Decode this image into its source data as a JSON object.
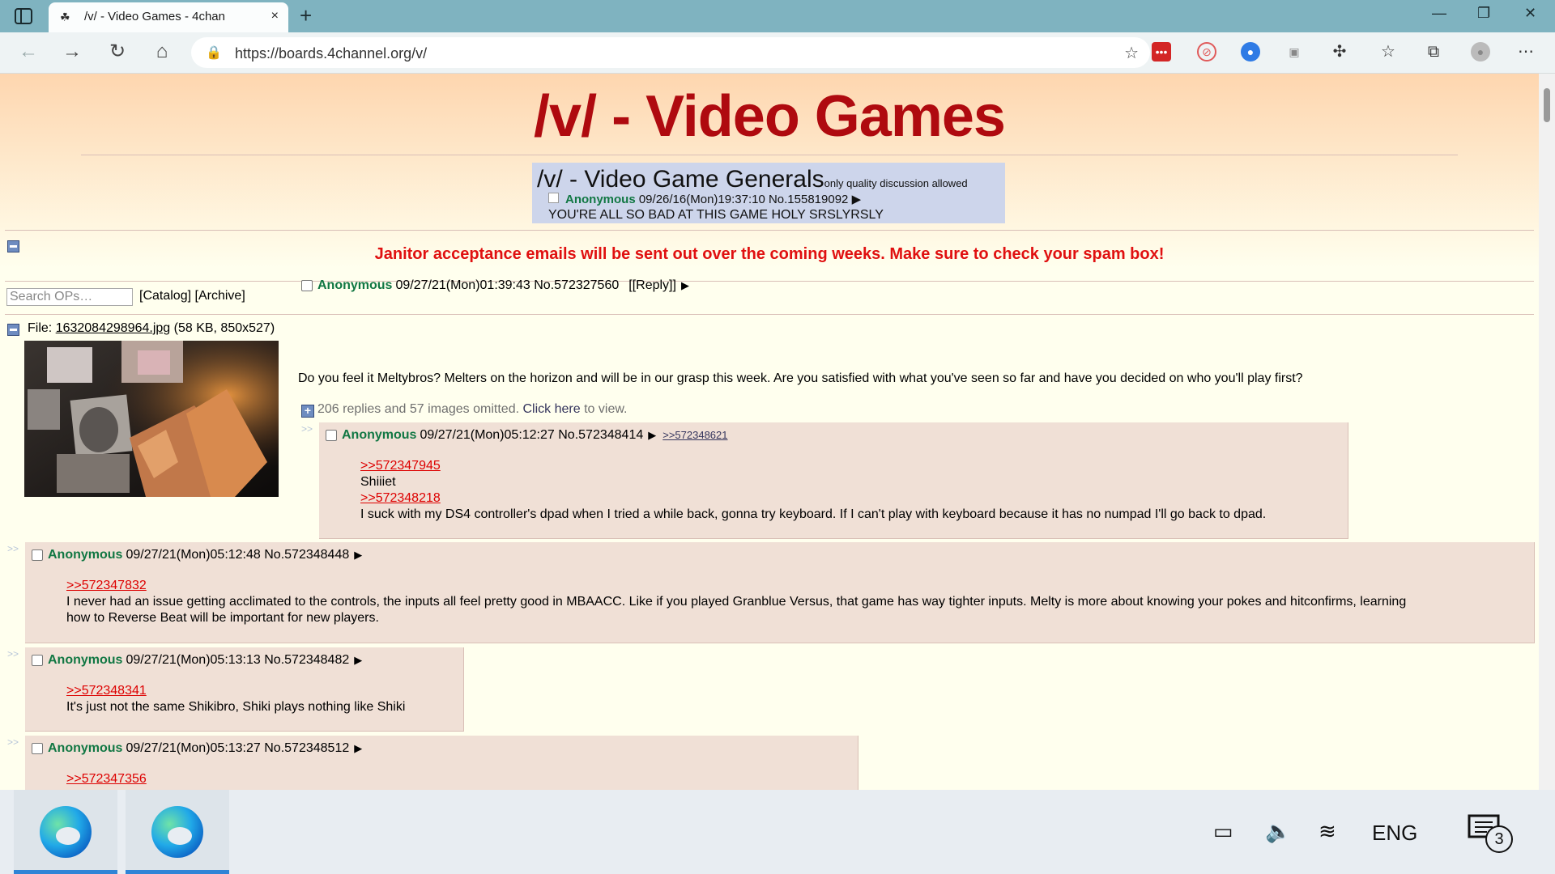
{
  "browser": {
    "tab_title": "/v/ - Video Games - 4chan",
    "url": "https://boards.4channel.org/v/",
    "new_tab": "+",
    "close_tab": "×"
  },
  "board": {
    "title": "/v/ - Video Games",
    "banner": {
      "title_main": "/v/  - Video Game Generals",
      "title_small": "only quality discussion allowed",
      "poster": "Anonymous",
      "meta": "09/26/16(Mon)19:37:10 No.155819092",
      "body": "YOU'RE ALL SO BAD AT THIS GAME HOLY SRSLYRSLY"
    },
    "announcement": "Janitor acceptance emails will be sent out over the coming weeks. Make sure to check your spam box!",
    "search_placeholder": "Search OPs…",
    "nav": {
      "catalog": "Catalog",
      "archive": "Archive"
    }
  },
  "op": {
    "file_label": "File:",
    "file_name": "1632084298964.jpg",
    "file_meta": "(58 KB, 850x527)",
    "name": "Anonymous",
    "datetime": "09/27/21(Mon)01:39:43",
    "number": "No.572327560",
    "reply_label": "[Reply]",
    "text": "Do you feel it Meltybros? Melters on the horizon and will be in our grasp this week. Are you satisfied with what you've seen so far and have you decided on who you'll play first?",
    "omitted_text": "206 replies and 57 images omitted.",
    "click_here": "Click here",
    "to_view": "to view."
  },
  "replies": [
    {
      "name": "Anonymous",
      "datetime": "09/27/21(Mon)05:12:27",
      "number": "No.572348414",
      "backlink": ">>572348621",
      "lines": [
        {
          "type": "quote",
          "text": ">>572347945"
        },
        {
          "type": "text",
          "text": "Shiiiet"
        },
        {
          "type": "quote",
          "text": ">>572348218"
        },
        {
          "type": "text",
          "text": "I suck with my DS4 controller's dpad when I tried a while back, gonna try keyboard. If I can't play with keyboard because it has no numpad I'll go back to dpad."
        }
      ]
    },
    {
      "name": "Anonymous",
      "datetime": "09/27/21(Mon)05:12:48",
      "number": "No.572348448",
      "lines": [
        {
          "type": "quote",
          "text": ">>572347832"
        },
        {
          "type": "text",
          "text": "I never had an issue getting acclimated to the controls, the inputs all feel pretty good in MBAACC. Like if you played Granblue Versus, that game has way tighter inputs. Melty is more about knowing your pokes and hitconfirms, learning"
        },
        {
          "type": "text",
          "text": "how to Reverse Beat will be important for new players."
        }
      ]
    },
    {
      "name": "Anonymous",
      "datetime": "09/27/21(Mon)05:13:13",
      "number": "No.572348482",
      "lines": [
        {
          "type": "quote",
          "text": ">>572348341"
        },
        {
          "type": "text",
          "text": "It's just not the same Shikibro, Shiki plays nothing like Shiki"
        }
      ]
    },
    {
      "name": "Anonymous",
      "datetime": "09/27/21(Mon)05:13:27",
      "number": "No.572348512",
      "lines": [
        {
          "type": "quote",
          "text": ">>572347356"
        }
      ]
    }
  ],
  "taskbar": {
    "language": "ENG",
    "notifications": "3"
  }
}
